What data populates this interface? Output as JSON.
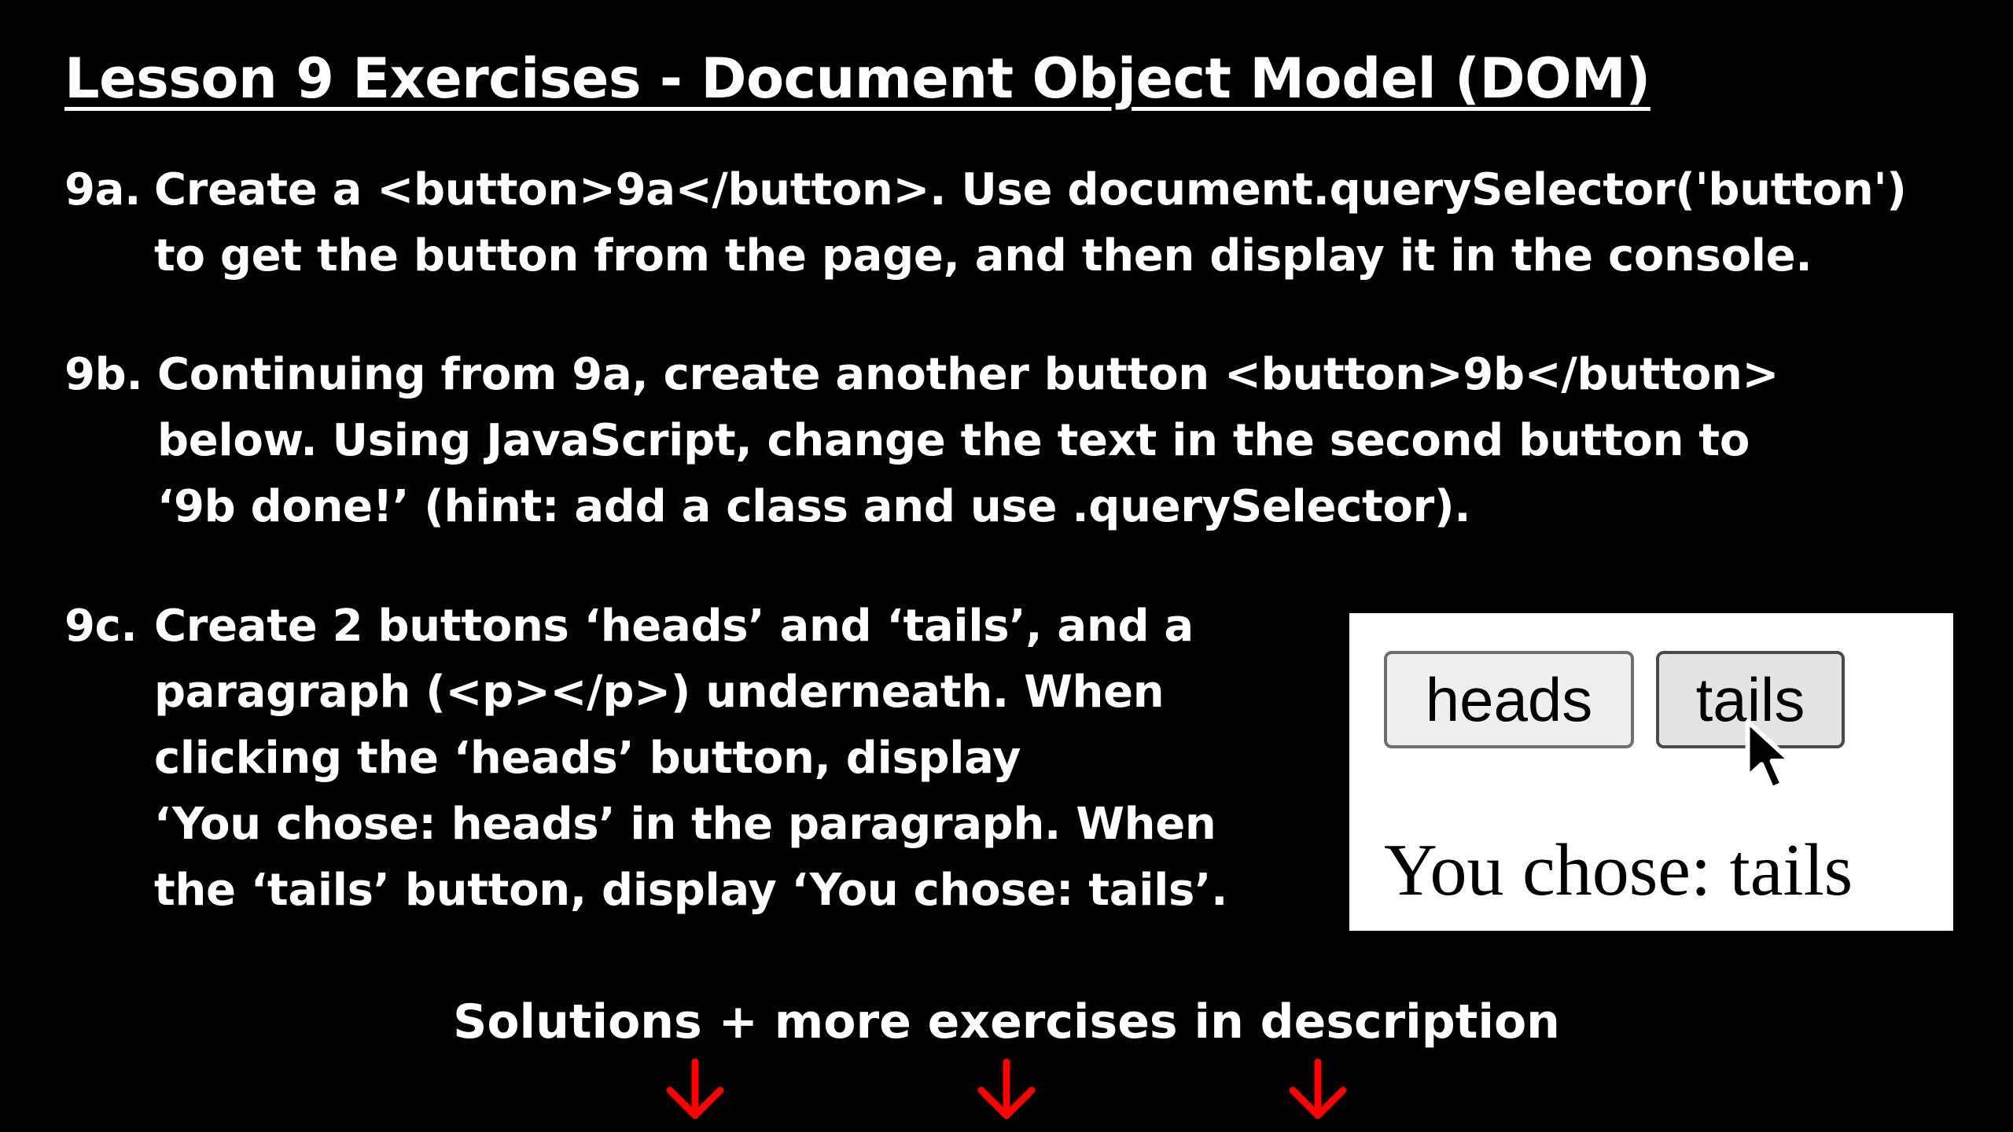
{
  "title": "Lesson 9 Exercises - Document Object Model (DOM)",
  "exercises": [
    {
      "label": "9a.",
      "lines": [
        "Create a <button>9a</button>. Use document.querySelector('button')",
        "to get the button from the page, and then display it in the console."
      ]
    },
    {
      "label": "9b.",
      "lines": [
        "Continuing from 9a, create another button <button>9b</button>",
        "below. Using JavaScript, change the text in the second button to",
        "‘9b done!’ (hint: add a class and use .querySelector)."
      ]
    },
    {
      "label": "9c.",
      "lines": [
        "Create 2 buttons ‘heads’ and ‘tails’, and a",
        "paragraph (<p></p>) underneath. When",
        "clicking the ‘heads’ button, display",
        "‘You chose: heads’ in the paragraph. When",
        "the ‘tails’ button, display ‘You chose: tails’."
      ]
    }
  ],
  "demo": {
    "heads_label": "heads",
    "tails_label": "tails",
    "output_text": "You chose: tails",
    "cursor_icon": "mouse-pointer-icon"
  },
  "footer": {
    "text": "Solutions + more exercises in description",
    "arrow_icon": "arrow-down-icon",
    "arrow_color": "#ff0000"
  }
}
